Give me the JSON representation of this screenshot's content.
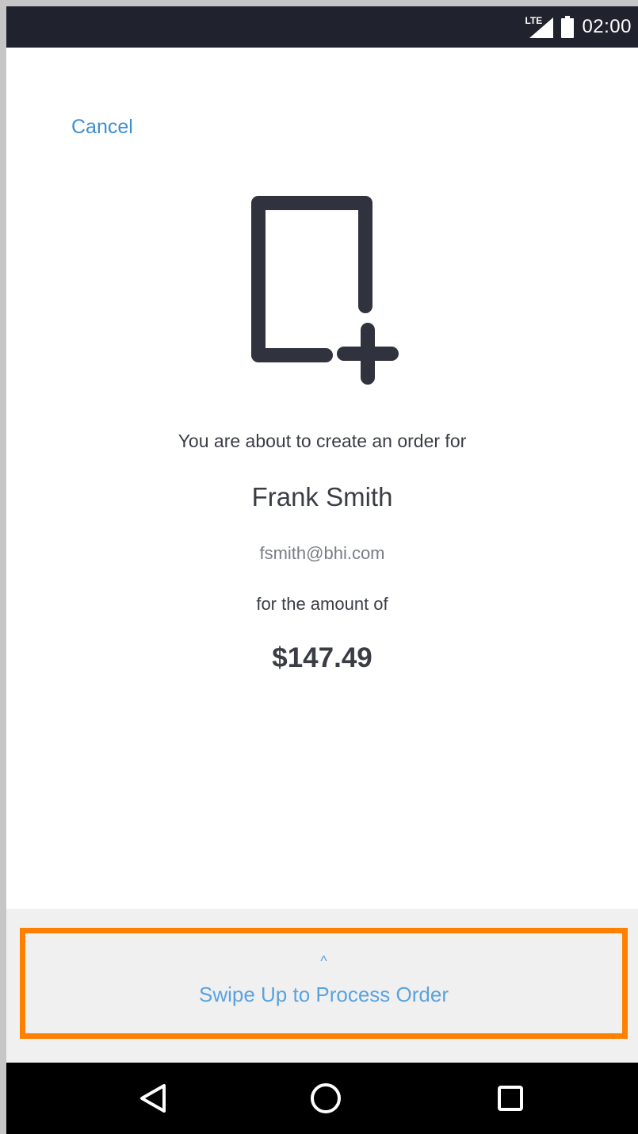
{
  "status_bar": {
    "network": "LTE",
    "time": "02:00",
    "icons": [
      "lte-signal-icon",
      "battery-icon"
    ]
  },
  "header": {
    "cancel_label": "Cancel"
  },
  "order": {
    "icon": "new-order-icon",
    "intro_text": "You are about to create an order for",
    "customer_name": "Frank Smith",
    "customer_email": "fsmith@bhi.com",
    "amount_label": "for the amount of",
    "amount": "$147.49"
  },
  "swipe": {
    "chevron": "^",
    "label": "Swipe Up to Process Order",
    "highlight_color": "#ff8000"
  },
  "nav_bar": {
    "icons": [
      "back-icon",
      "home-icon",
      "recents-icon"
    ]
  },
  "colors": {
    "accent": "#3d8fd2",
    "text": "#3a3d44",
    "status_bar": "#20232d"
  }
}
